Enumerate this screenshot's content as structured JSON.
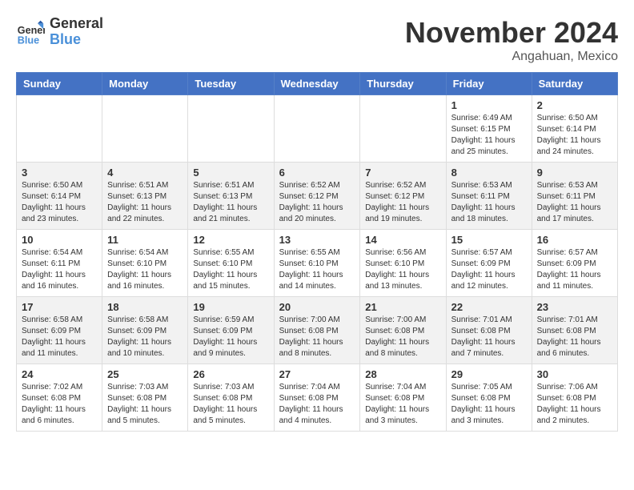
{
  "header": {
    "logo_general": "General",
    "logo_blue": "Blue",
    "month": "November 2024",
    "location": "Angahuan, Mexico"
  },
  "days_of_week": [
    "Sunday",
    "Monday",
    "Tuesday",
    "Wednesday",
    "Thursday",
    "Friday",
    "Saturday"
  ],
  "weeks": [
    [
      {
        "day": "",
        "info": ""
      },
      {
        "day": "",
        "info": ""
      },
      {
        "day": "",
        "info": ""
      },
      {
        "day": "",
        "info": ""
      },
      {
        "day": "",
        "info": ""
      },
      {
        "day": "1",
        "info": "Sunrise: 6:49 AM\nSunset: 6:15 PM\nDaylight: 11 hours and 25 minutes."
      },
      {
        "day": "2",
        "info": "Sunrise: 6:50 AM\nSunset: 6:14 PM\nDaylight: 11 hours and 24 minutes."
      }
    ],
    [
      {
        "day": "3",
        "info": "Sunrise: 6:50 AM\nSunset: 6:14 PM\nDaylight: 11 hours and 23 minutes."
      },
      {
        "day": "4",
        "info": "Sunrise: 6:51 AM\nSunset: 6:13 PM\nDaylight: 11 hours and 22 minutes."
      },
      {
        "day": "5",
        "info": "Sunrise: 6:51 AM\nSunset: 6:13 PM\nDaylight: 11 hours and 21 minutes."
      },
      {
        "day": "6",
        "info": "Sunrise: 6:52 AM\nSunset: 6:12 PM\nDaylight: 11 hours and 20 minutes."
      },
      {
        "day": "7",
        "info": "Sunrise: 6:52 AM\nSunset: 6:12 PM\nDaylight: 11 hours and 19 minutes."
      },
      {
        "day": "8",
        "info": "Sunrise: 6:53 AM\nSunset: 6:11 PM\nDaylight: 11 hours and 18 minutes."
      },
      {
        "day": "9",
        "info": "Sunrise: 6:53 AM\nSunset: 6:11 PM\nDaylight: 11 hours and 17 minutes."
      }
    ],
    [
      {
        "day": "10",
        "info": "Sunrise: 6:54 AM\nSunset: 6:11 PM\nDaylight: 11 hours and 16 minutes."
      },
      {
        "day": "11",
        "info": "Sunrise: 6:54 AM\nSunset: 6:10 PM\nDaylight: 11 hours and 16 minutes."
      },
      {
        "day": "12",
        "info": "Sunrise: 6:55 AM\nSunset: 6:10 PM\nDaylight: 11 hours and 15 minutes."
      },
      {
        "day": "13",
        "info": "Sunrise: 6:55 AM\nSunset: 6:10 PM\nDaylight: 11 hours and 14 minutes."
      },
      {
        "day": "14",
        "info": "Sunrise: 6:56 AM\nSunset: 6:10 PM\nDaylight: 11 hours and 13 minutes."
      },
      {
        "day": "15",
        "info": "Sunrise: 6:57 AM\nSunset: 6:09 PM\nDaylight: 11 hours and 12 minutes."
      },
      {
        "day": "16",
        "info": "Sunrise: 6:57 AM\nSunset: 6:09 PM\nDaylight: 11 hours and 11 minutes."
      }
    ],
    [
      {
        "day": "17",
        "info": "Sunrise: 6:58 AM\nSunset: 6:09 PM\nDaylight: 11 hours and 11 minutes."
      },
      {
        "day": "18",
        "info": "Sunrise: 6:58 AM\nSunset: 6:09 PM\nDaylight: 11 hours and 10 minutes."
      },
      {
        "day": "19",
        "info": "Sunrise: 6:59 AM\nSunset: 6:09 PM\nDaylight: 11 hours and 9 minutes."
      },
      {
        "day": "20",
        "info": "Sunrise: 7:00 AM\nSunset: 6:08 PM\nDaylight: 11 hours and 8 minutes."
      },
      {
        "day": "21",
        "info": "Sunrise: 7:00 AM\nSunset: 6:08 PM\nDaylight: 11 hours and 8 minutes."
      },
      {
        "day": "22",
        "info": "Sunrise: 7:01 AM\nSunset: 6:08 PM\nDaylight: 11 hours and 7 minutes."
      },
      {
        "day": "23",
        "info": "Sunrise: 7:01 AM\nSunset: 6:08 PM\nDaylight: 11 hours and 6 minutes."
      }
    ],
    [
      {
        "day": "24",
        "info": "Sunrise: 7:02 AM\nSunset: 6:08 PM\nDaylight: 11 hours and 6 minutes."
      },
      {
        "day": "25",
        "info": "Sunrise: 7:03 AM\nSunset: 6:08 PM\nDaylight: 11 hours and 5 minutes."
      },
      {
        "day": "26",
        "info": "Sunrise: 7:03 AM\nSunset: 6:08 PM\nDaylight: 11 hours and 5 minutes."
      },
      {
        "day": "27",
        "info": "Sunrise: 7:04 AM\nSunset: 6:08 PM\nDaylight: 11 hours and 4 minutes."
      },
      {
        "day": "28",
        "info": "Sunrise: 7:04 AM\nSunset: 6:08 PM\nDaylight: 11 hours and 3 minutes."
      },
      {
        "day": "29",
        "info": "Sunrise: 7:05 AM\nSunset: 6:08 PM\nDaylight: 11 hours and 3 minutes."
      },
      {
        "day": "30",
        "info": "Sunrise: 7:06 AM\nSunset: 6:08 PM\nDaylight: 11 hours and 2 minutes."
      }
    ]
  ]
}
